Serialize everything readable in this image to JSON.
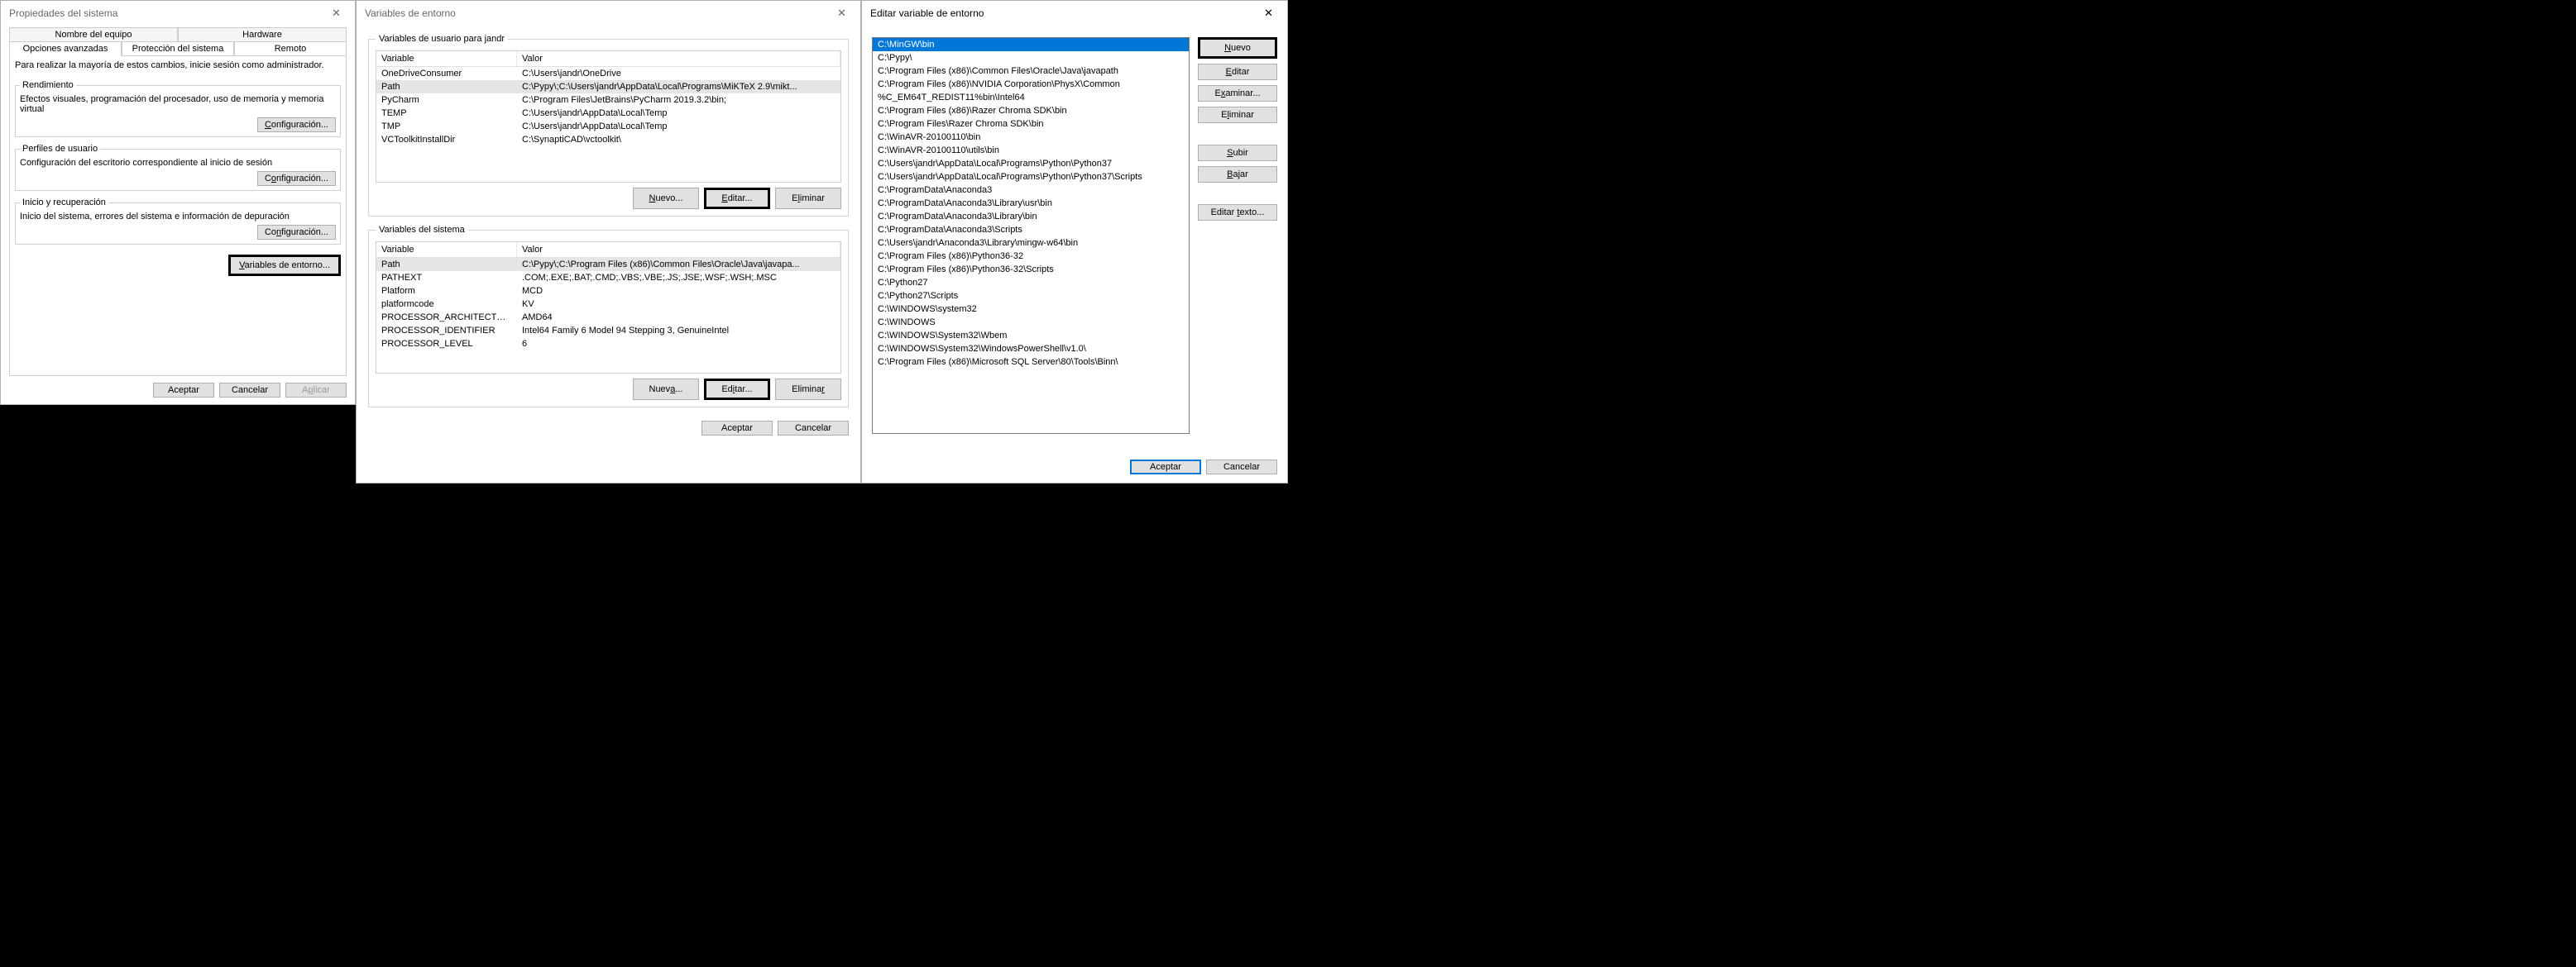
{
  "w1": {
    "title": "Propiedades del sistema",
    "tabs_top": [
      "Nombre del equipo",
      "Hardware"
    ],
    "tabs_bot": [
      "Opciones avanzadas",
      "Protección del sistema",
      "Remoto"
    ],
    "intro": "Para realizar la mayoría de estos cambios, inicie sesión como administrador.",
    "grp1_title": "Rendimiento",
    "grp1_desc": "Efectos visuales, programación del procesador, uso de memoria y memoria virtual",
    "grp2_title": "Perfiles de usuario",
    "grp2_desc": "Configuración del escritorio correspondiente al inicio de sesión",
    "grp3_title": "Inicio y recuperación",
    "grp3_desc": "Inicio del sistema, errores del sistema e información de depuración",
    "cfg_btn": "Configuración...",
    "envvars_btn": "Variables de entorno...",
    "ok": "Aceptar",
    "cancel": "Cancelar",
    "apply": "Aplicar"
  },
  "w2": {
    "title": "Variables de entorno",
    "user_legend": "Variables de usuario para jandr",
    "sys_legend": "Variables del sistema",
    "col_var": "Variable",
    "col_val": "Valor",
    "user_rows": [
      {
        "v": "OneDriveConsumer",
        "val": "C:\\Users\\jandr\\OneDrive"
      },
      {
        "v": "Path",
        "val": "C:\\Pypy\\;C:\\Users\\jandr\\AppData\\Local\\Programs\\MiKTeX 2.9\\mikt...",
        "sel": true
      },
      {
        "v": "PyCharm",
        "val": "C:\\Program Files\\JetBrains\\PyCharm 2019.3.2\\bin;"
      },
      {
        "v": "TEMP",
        "val": "C:\\Users\\jandr\\AppData\\Local\\Temp"
      },
      {
        "v": "TMP",
        "val": "C:\\Users\\jandr\\AppData\\Local\\Temp"
      },
      {
        "v": "VCToolkitInstallDir",
        "val": "C:\\SynaptiCAD\\vctoolkit\\"
      }
    ],
    "sys_rows": [
      {
        "v": "Path",
        "val": "C:\\Pypy\\;C:\\Program Files (x86)\\Common Files\\Oracle\\Java\\javapa...",
        "sel": true
      },
      {
        "v": "PATHEXT",
        "val": ".COM;.EXE;.BAT;.CMD;.VBS;.VBE;.JS;.JSE;.WSF;.WSH;.MSC"
      },
      {
        "v": "Platform",
        "val": "MCD"
      },
      {
        "v": "platformcode",
        "val": "KV"
      },
      {
        "v": "PROCESSOR_ARCHITECTURE",
        "val": "AMD64"
      },
      {
        "v": "PROCESSOR_IDENTIFIER",
        "val": "Intel64 Family 6 Model 94 Stepping 3, GenuineIntel"
      },
      {
        "v": "PROCESSOR_LEVEL",
        "val": "6"
      }
    ],
    "new_btn_u": "Nuevo...",
    "new_btn_s": "Nueva...",
    "edit_btn_u": "Editar...",
    "edit_btn_s": "Editar...",
    "del_btn": "Eliminar",
    "ok": "Aceptar",
    "cancel": "Cancelar"
  },
  "w3": {
    "title": "Editar variable de entorno",
    "entries": [
      {
        "t": "C:\\MinGW\\bin",
        "sel": true
      },
      {
        "t": "C:\\Pypy\\"
      },
      {
        "t": "C:\\Program Files (x86)\\Common Files\\Oracle\\Java\\javapath"
      },
      {
        "t": "C:\\Program Files (x86)\\NVIDIA Corporation\\PhysX\\Common"
      },
      {
        "t": "%C_EM64T_REDIST11%bin\\Intel64"
      },
      {
        "t": "C:\\Program Files (x86)\\Razer Chroma SDK\\bin"
      },
      {
        "t": "C:\\Program Files\\Razer Chroma SDK\\bin"
      },
      {
        "t": "C:\\WinAVR-20100110\\bin"
      },
      {
        "t": "C:\\WinAVR-20100110\\utils\\bin"
      },
      {
        "t": "C:\\Users\\jandr\\AppData\\Local\\Programs\\Python\\Python37"
      },
      {
        "t": "C:\\Users\\jandr\\AppData\\Local\\Programs\\Python\\Python37\\Scripts"
      },
      {
        "t": "C:\\ProgramData\\Anaconda3"
      },
      {
        "t": "C:\\ProgramData\\Anaconda3\\Library\\usr\\bin"
      },
      {
        "t": "C:\\ProgramData\\Anaconda3\\Library\\bin"
      },
      {
        "t": "C:\\ProgramData\\Anaconda3\\Scripts"
      },
      {
        "t": "C:\\Users\\jandr\\Anaconda3\\Library\\mingw-w64\\bin"
      },
      {
        "t": "C:\\Program Files (x86)\\Python36-32"
      },
      {
        "t": "C:\\Program Files (x86)\\Python36-32\\Scripts"
      },
      {
        "t": "C:\\Python27"
      },
      {
        "t": "C:\\Python27\\Scripts"
      },
      {
        "t": "C:\\WINDOWS\\system32"
      },
      {
        "t": "C:\\WINDOWS"
      },
      {
        "t": "C:\\WINDOWS\\System32\\Wbem"
      },
      {
        "t": "C:\\WINDOWS\\System32\\WindowsPowerShell\\v1.0\\"
      },
      {
        "t": "C:\\Program Files (x86)\\Microsoft SQL Server\\80\\Tools\\Binn\\"
      }
    ],
    "btn_new": "Nuevo",
    "btn_edit": "Editar",
    "btn_browse": "Examinar...",
    "btn_delete": "Eliminar",
    "btn_up": "Subir",
    "btn_down": "Bajar",
    "btn_edit_text": "Editar texto...",
    "ok": "Aceptar",
    "cancel": "Cancelar"
  }
}
